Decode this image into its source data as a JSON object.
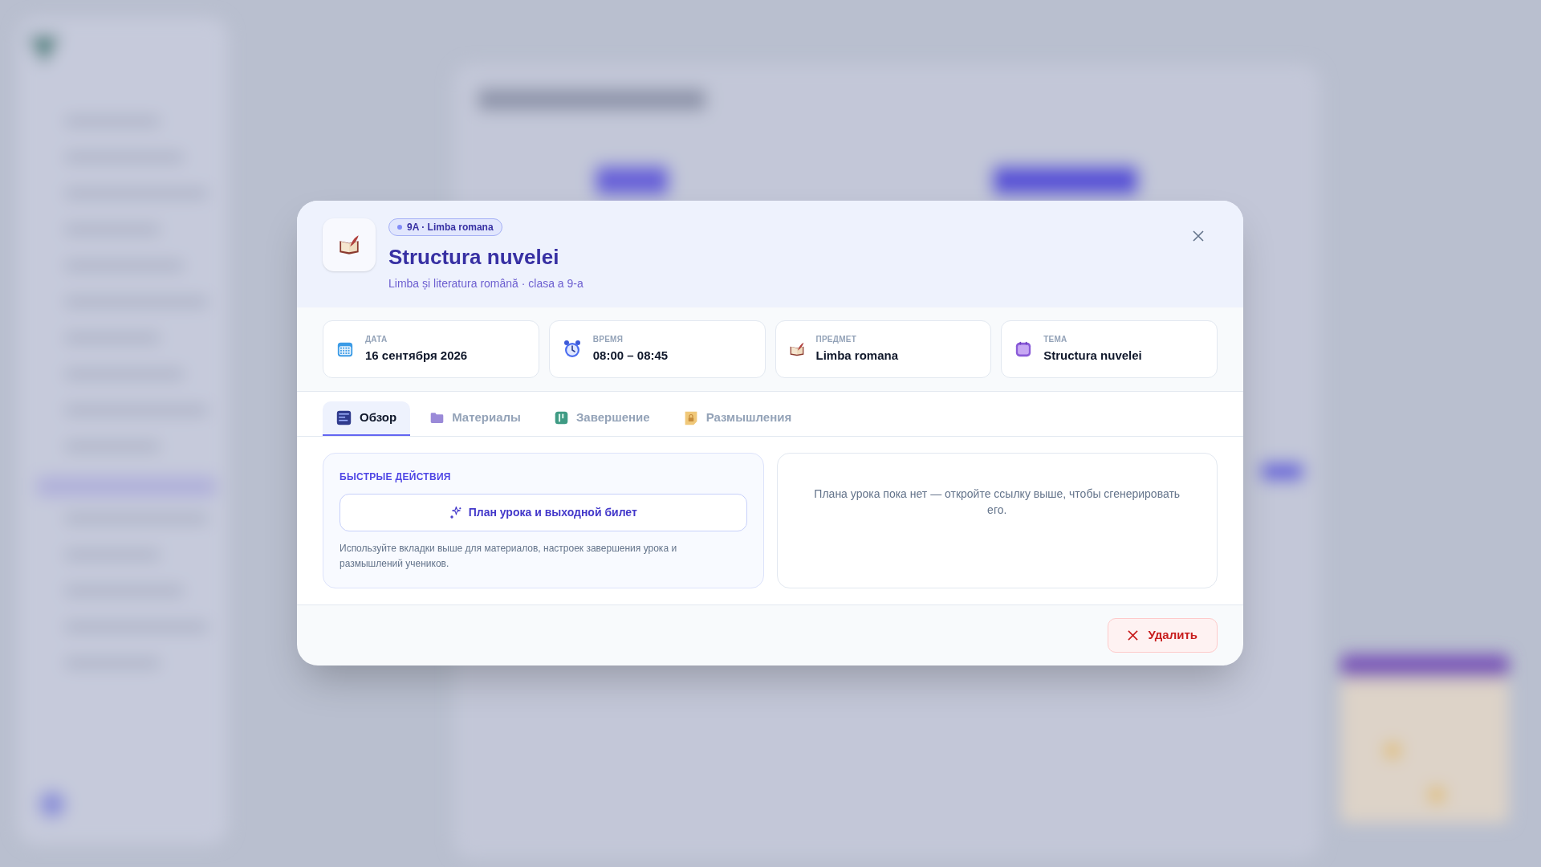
{
  "lesson": {
    "badge": "9A · Limba romana",
    "title": "Structura nuvelei",
    "subtitle": "Limba și literatura română · clasa a 9-a"
  },
  "info_cards": [
    {
      "kind": "date",
      "label": "ДАТА",
      "value": "16 сентября 2026"
    },
    {
      "kind": "time",
      "label": "ВРЕМЯ",
      "value": "08:00 – 08:45"
    },
    {
      "kind": "subject",
      "label": "ПРЕДМЕТ",
      "value": "Limba romana"
    },
    {
      "kind": "topic",
      "label": "ТЕМА",
      "value": "Structura nuvelei"
    }
  ],
  "tabs": [
    {
      "kind": "overview",
      "label": "Обзор",
      "selected": true
    },
    {
      "kind": "materials",
      "label": "Материалы",
      "selected": false
    },
    {
      "kind": "completion",
      "label": "Завершение",
      "selected": false
    },
    {
      "kind": "reflection",
      "label": "Размышления",
      "selected": false
    }
  ],
  "quick_actions": {
    "heading": "БЫСТРЫЕ ДЕЙСТВИЯ",
    "button": "План урока и выходной билет",
    "hint": "Используйте вкладки выше для материалов, настроек завершения урока и размышлений учеников."
  },
  "plan_placeholder": "Плана урока пока нет — откройте ссылку выше, чтобы сгенерировать его.",
  "footer": {
    "delete_button": "Удалить"
  }
}
